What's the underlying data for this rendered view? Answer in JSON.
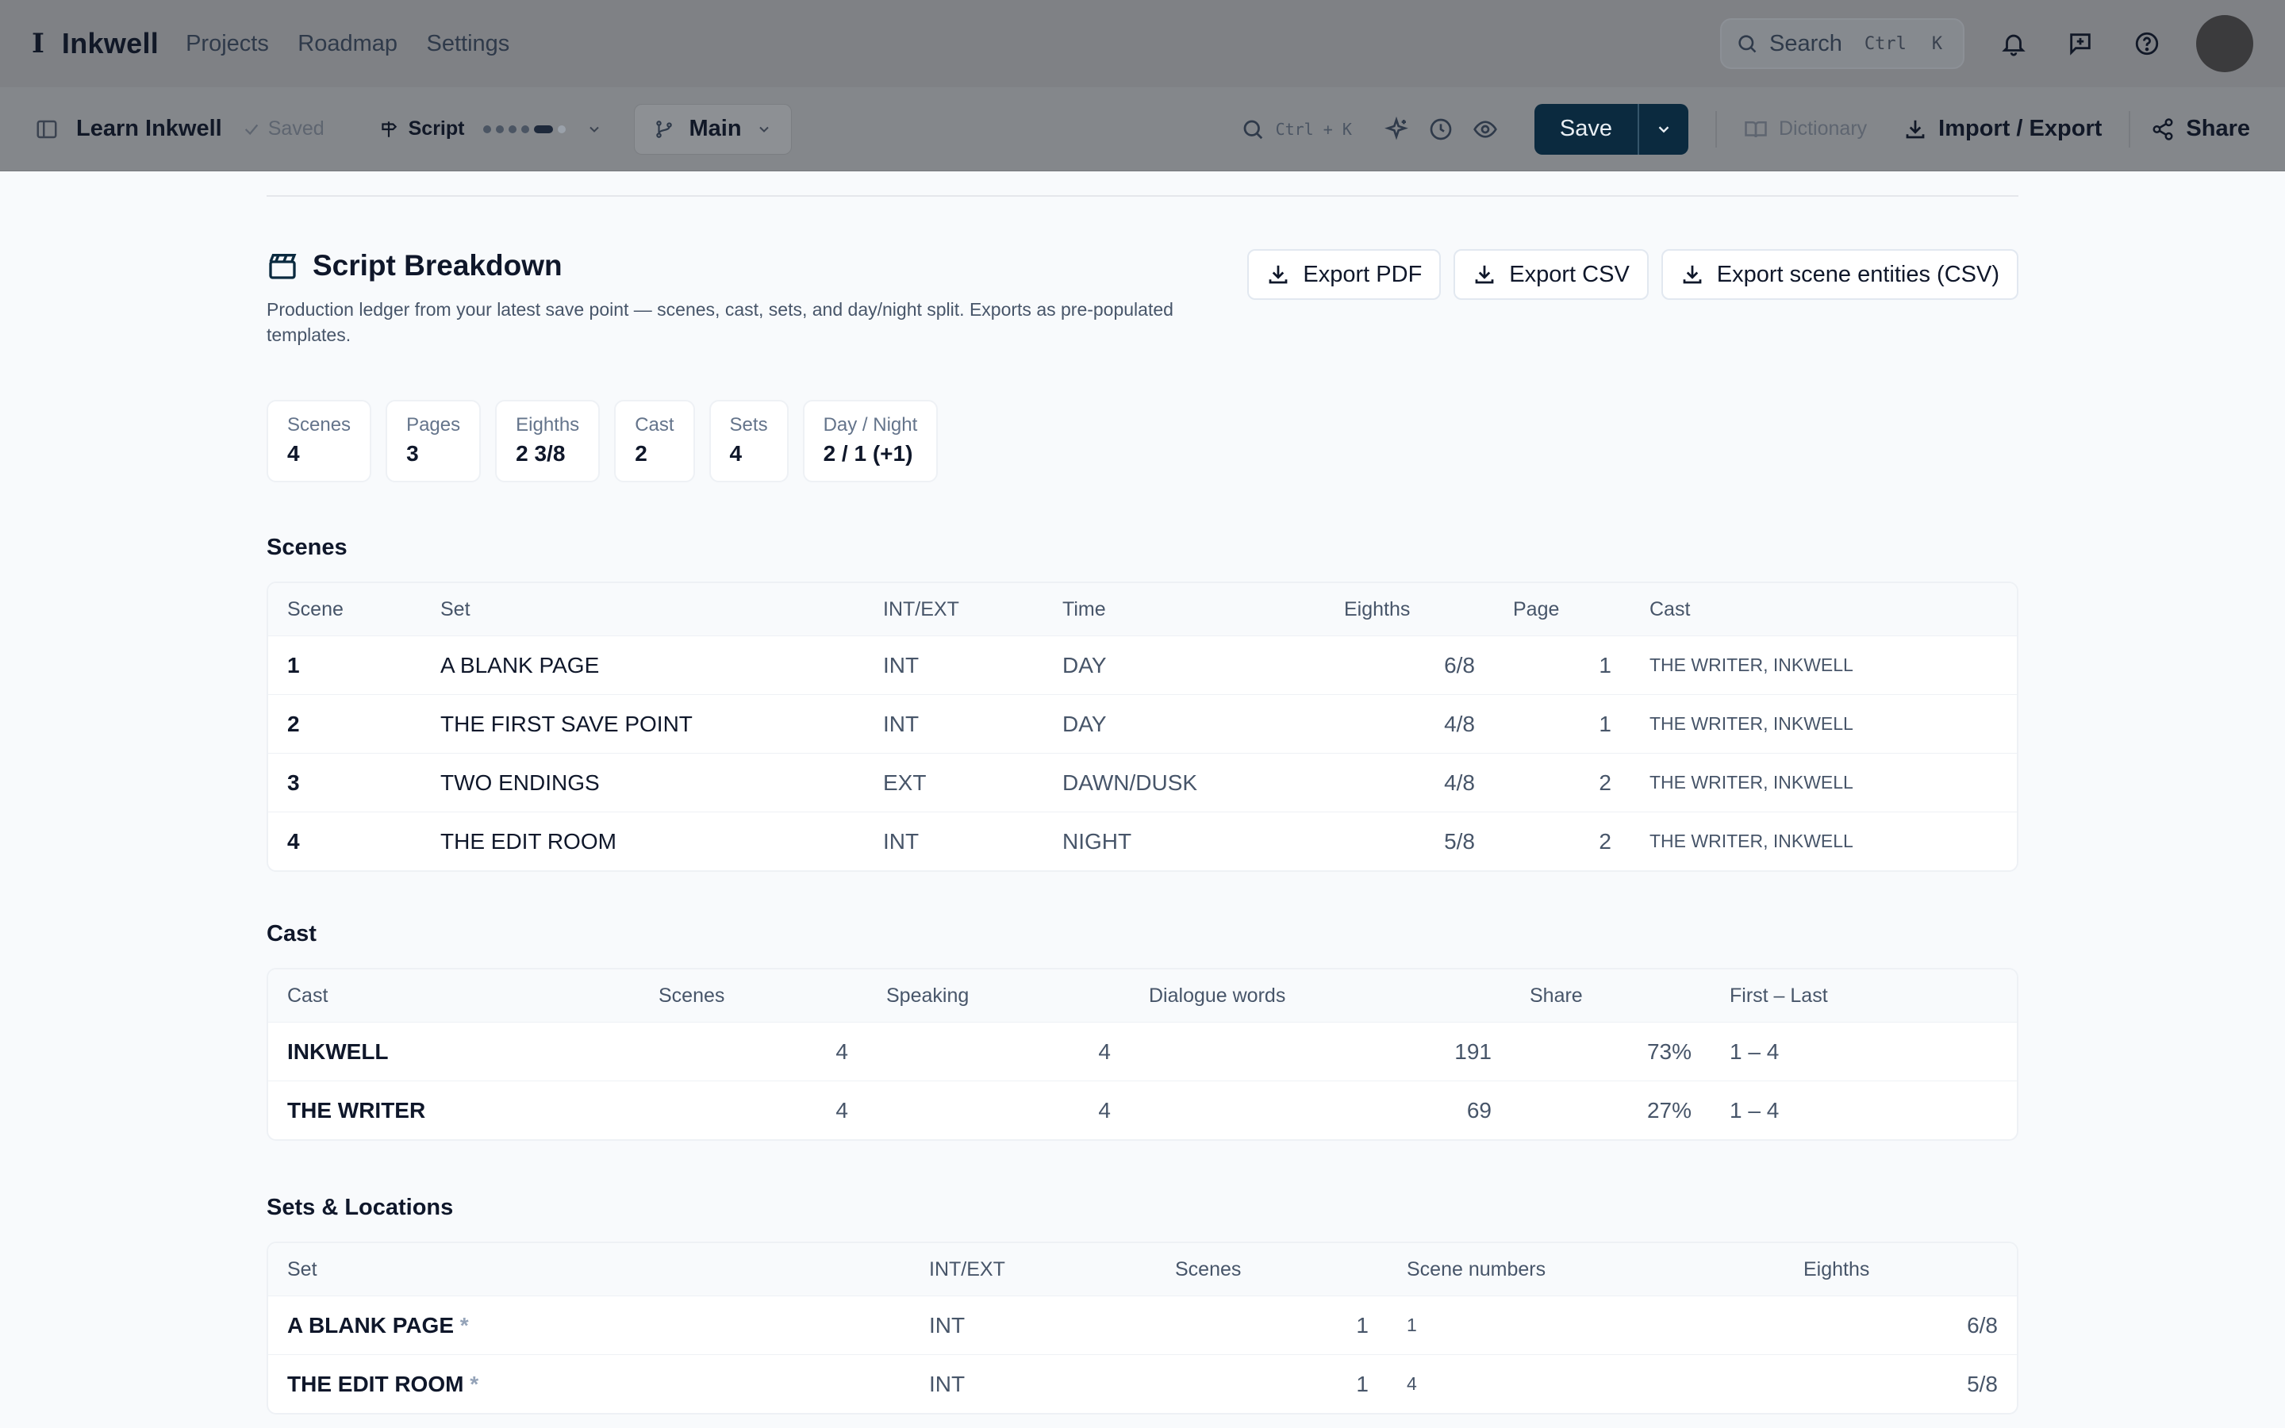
{
  "app": {
    "brand_mark": "I",
    "name": "Inkwell",
    "nav": [
      "Projects",
      "Roadmap",
      "Settings"
    ],
    "search_label": "Search",
    "search_kbd": [
      "Ctrl",
      "K"
    ]
  },
  "toolbar": {
    "doc_title": "Learn Inkwell",
    "saved": "Saved",
    "mode": "Script",
    "branch": "Main",
    "kbd": "Ctrl + K",
    "save": "Save",
    "dictionary": "Dictionary",
    "import_export": "Import / Export",
    "share": "Share"
  },
  "page": {
    "title": "Script Breakdown",
    "subtitle": "Production ledger from your latest save point — scenes, cast, sets, and day/night split. Exports as pre-populated templates.",
    "exports": [
      "Export PDF",
      "Export CSV",
      "Export scene entities (CSV)"
    ]
  },
  "stats": [
    {
      "label": "Scenes",
      "value": "4"
    },
    {
      "label": "Pages",
      "value": "3"
    },
    {
      "label": "Eighths",
      "value": "2 3/8"
    },
    {
      "label": "Cast",
      "value": "2"
    },
    {
      "label": "Sets",
      "value": "4"
    },
    {
      "label": "Day / Night",
      "value": "2 / 1 (+1)"
    }
  ],
  "scenes": {
    "title": "Scenes",
    "headers": [
      "Scene",
      "Set",
      "INT/EXT",
      "Time",
      "Eighths",
      "Page",
      "Cast"
    ],
    "rows": [
      [
        "1",
        "A BLANK PAGE",
        "INT",
        "DAY",
        "6/8",
        "1",
        "THE WRITER, INKWELL"
      ],
      [
        "2",
        "THE FIRST SAVE POINT",
        "INT",
        "DAY",
        "4/8",
        "1",
        "THE WRITER, INKWELL"
      ],
      [
        "3",
        "TWO ENDINGS",
        "EXT",
        "DAWN/DUSK",
        "4/8",
        "2",
        "THE WRITER, INKWELL"
      ],
      [
        "4",
        "THE EDIT ROOM",
        "INT",
        "NIGHT",
        "5/8",
        "2",
        "THE WRITER, INKWELL"
      ]
    ]
  },
  "cast": {
    "title": "Cast",
    "headers": [
      "Cast",
      "Scenes",
      "Speaking",
      "Dialogue words",
      "Share",
      "First – Last"
    ],
    "rows": [
      [
        "INKWELL",
        "4",
        "4",
        "191",
        "73%",
        "1 – 4"
      ],
      [
        "THE WRITER",
        "4",
        "4",
        "69",
        "27%",
        "1 – 4"
      ]
    ]
  },
  "sets": {
    "title": "Sets & Locations",
    "headers": [
      "Set",
      "INT/EXT",
      "Scenes",
      "Scene numbers",
      "Eighths"
    ],
    "rows": [
      [
        "A BLANK PAGE",
        "*",
        "INT",
        "1",
        "1",
        "6/8"
      ],
      [
        "THE EDIT ROOM",
        "*",
        "INT",
        "1",
        "4",
        "5/8"
      ]
    ]
  }
}
